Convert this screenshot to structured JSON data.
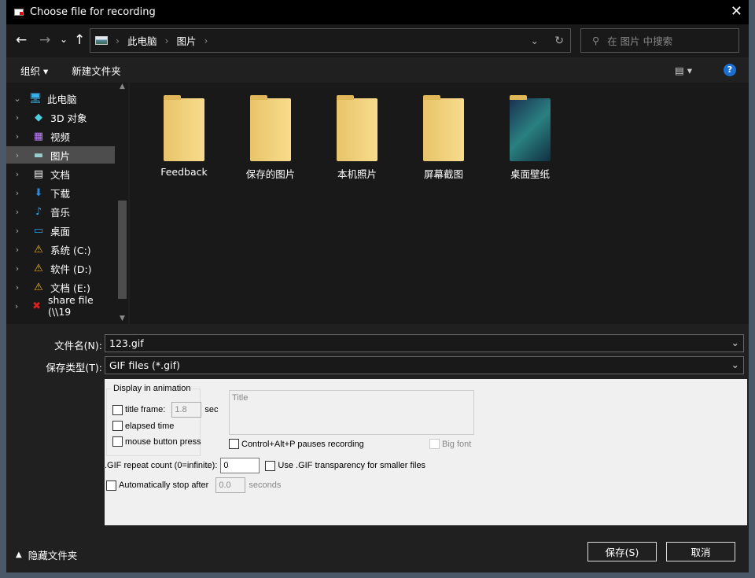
{
  "window": {
    "title": "Choose file for recording",
    "close": "✕"
  },
  "nav": {
    "back": "←",
    "forward": "→",
    "recent": "⌄",
    "up": "↑",
    "breadcrumb": [
      "此电脑",
      "图片"
    ],
    "refresh": "↻",
    "dropdown": "⌄",
    "search_placeholder": "在 图片 中搜索"
  },
  "toolbar": {
    "organize": "组织 ▾",
    "new_folder": "新建文件夹",
    "view": "▤ ▾",
    "help": "?"
  },
  "sidebar": {
    "items": [
      {
        "label": "此电脑",
        "icon": "computer-icon",
        "chev": "⌄"
      },
      {
        "label": "3D 对象",
        "icon": "cube-icon",
        "chev": "›"
      },
      {
        "label": "视频",
        "icon": "video-icon",
        "chev": "›"
      },
      {
        "label": "图片",
        "icon": "picture-icon",
        "chev": "›"
      },
      {
        "label": "文档",
        "icon": "document-icon",
        "chev": "›"
      },
      {
        "label": "下载",
        "icon": "download-icon",
        "chev": "›"
      },
      {
        "label": "音乐",
        "icon": "music-icon",
        "chev": "›"
      },
      {
        "label": "桌面",
        "icon": "desktop-icon",
        "chev": "›"
      },
      {
        "label": "系统 (C:)",
        "icon": "drive-warning-icon",
        "chev": "›"
      },
      {
        "label": "软件 (D:)",
        "icon": "drive-warning-icon",
        "chev": "›"
      },
      {
        "label": "文档 (E:)",
        "icon": "drive-warning-icon",
        "chev": "›"
      },
      {
        "label": "share file (\\\\19",
        "icon": "network-drive-disconnected-icon",
        "chev": "›"
      }
    ]
  },
  "folders": [
    "Feedback",
    "保存的图片",
    "本机照片",
    "屏幕截图",
    "桌面壁纸"
  ],
  "form": {
    "filename_label": "文件名(N):",
    "filename": "123.gif",
    "type_label": "保存类型(T):",
    "type": "GIF files (*.gif)"
  },
  "options": {
    "group": "Display in animation",
    "title_frame": "title frame:",
    "title_frame_value": "1.8",
    "sec": "sec",
    "elapsed": "elapsed time",
    "mouse": "mouse button press",
    "title_placeholder": "Title",
    "pause": "Control+Alt+P pauses recording",
    "big_font": "Big font",
    "repeat_label": ".GIF repeat count (0=infinite):",
    "repeat_value": "0",
    "transparency": "Use .GIF transparency for smaller files",
    "auto_stop": "Automatically stop after",
    "auto_stop_value": "0.0",
    "seconds": "seconds"
  },
  "footer": {
    "hide_folders": "隐藏文件夹",
    "save": "保存(S)",
    "cancel": "取消"
  }
}
